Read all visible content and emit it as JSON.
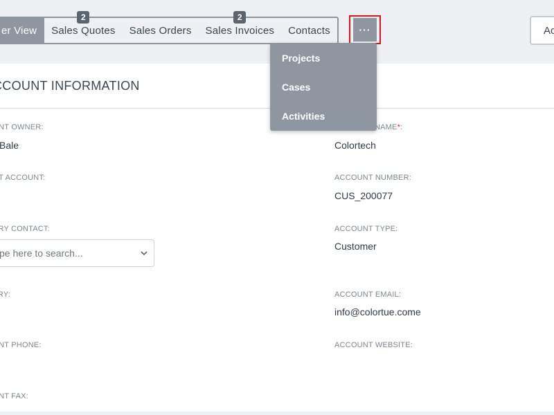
{
  "tabs": [
    {
      "label": "er View",
      "badge": ""
    },
    {
      "label": "Sales Quotes",
      "badge": "2"
    },
    {
      "label": "Sales Orders",
      "badge": ""
    },
    {
      "label": "Sales Invoices",
      "badge": "2"
    },
    {
      "label": "Contacts",
      "badge": ""
    }
  ],
  "more_button": {
    "label": "···"
  },
  "right_button": {
    "label": "Ac"
  },
  "dropdown": {
    "items": [
      "Projects",
      "Cases",
      "Activities"
    ]
  },
  "section": {
    "title": "CCOUNT INFORMATION"
  },
  "fields": {
    "account_owner": {
      "label": "UNT OWNER:",
      "value": "Bale"
    },
    "account_name": {
      "label": "NAME",
      "required_mark": "*",
      "suffix": ":",
      "value": "Colortech"
    },
    "parent_account": {
      "label": "NT ACCOUNT:",
      "value": ""
    },
    "account_number": {
      "label": "ACCOUNT NUMBER:",
      "value": "CUS_200077"
    },
    "primary_contact": {
      "label": "ARY CONTACT:",
      "placeholder": "pe here to search..."
    },
    "account_type": {
      "label": "ACCOUNT TYPE:",
      "value": "Customer"
    },
    "country": {
      "label": "TRY:",
      "value": ""
    },
    "account_email": {
      "label": "ACCOUNT EMAIL:",
      "value": "info@colortue.come"
    },
    "account_phone": {
      "label": "UNT PHONE:",
      "value": ""
    },
    "account_website": {
      "label": "ACCOUNT WEBSITE:",
      "value": ""
    },
    "account_fax": {
      "label": "UNT FAX:",
      "value": ""
    }
  },
  "colors": {
    "accent": "#8e979f",
    "highlight": "#e0141d",
    "badge": "#5a6570"
  }
}
